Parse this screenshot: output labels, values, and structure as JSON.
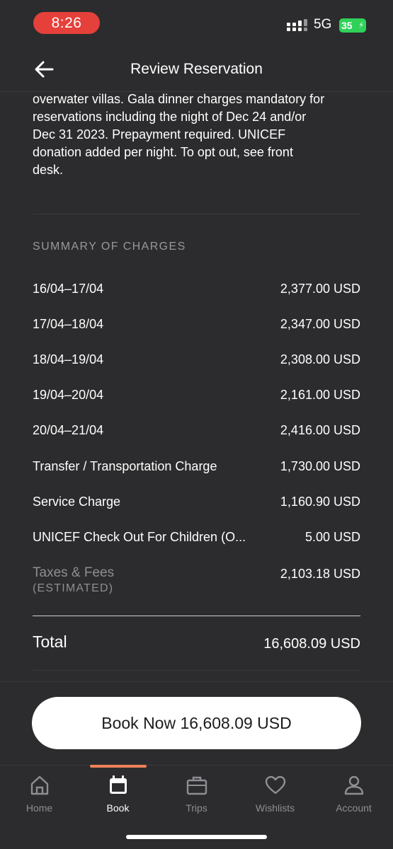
{
  "status_bar": {
    "time": "8:26",
    "network": "5G",
    "battery": "35"
  },
  "header": {
    "title": "Review Reservation"
  },
  "policy": {
    "lines": [
      "overwater villas. Gala dinner charges mandatory for",
      "reservations including the night of Dec 24 and/or",
      "Dec 31 2023. Prepayment required. UNICEF",
      "donation added per night. To opt out, see front",
      "desk."
    ]
  },
  "summary": {
    "title": "SUMMARY OF CHARGES",
    "rows": [
      {
        "label": "16/04–17/04",
        "value": "2,377.00 USD"
      },
      {
        "label": "17/04–18/04",
        "value": "2,347.00 USD"
      },
      {
        "label": "18/04–19/04",
        "value": "2,308.00 USD"
      },
      {
        "label": "19/04–20/04",
        "value": "2,161.00 USD"
      },
      {
        "label": "20/04–21/04",
        "value": "2,416.00 USD"
      },
      {
        "label": "Transfer / Transportation Charge",
        "value": "1,730.00 USD"
      },
      {
        "label": "Service Charge",
        "value": "1,160.90 USD"
      },
      {
        "label": "UNICEF Check Out For Children (O...",
        "value": "5.00 USD"
      }
    ],
    "taxes": {
      "label": "Taxes & Fees",
      "sub": "(ESTIMATED)",
      "value": "2,103.18 USD"
    },
    "total": {
      "label": "Total",
      "value": "16,608.09 USD"
    }
  },
  "book_button": {
    "label": "Book Now 16,608.09 USD"
  },
  "tabs": [
    {
      "label": "Home",
      "icon": "home-icon"
    },
    {
      "label": "Book",
      "icon": "calendar-icon",
      "active": true
    },
    {
      "label": "Trips",
      "icon": "briefcase-icon"
    },
    {
      "label": "Wishlists",
      "icon": "heart-icon"
    },
    {
      "label": "Account",
      "icon": "person-icon"
    }
  ],
  "colors": {
    "background": "#2c2c2e",
    "time_pill": "#e5403a",
    "battery": "#30d158",
    "active_tab_indicator": "#f0805a"
  }
}
